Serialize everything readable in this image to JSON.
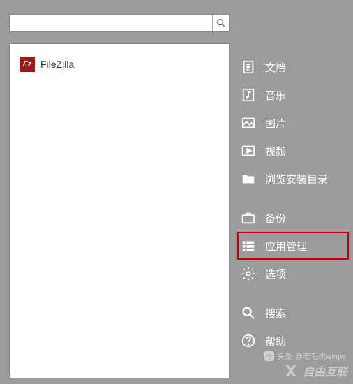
{
  "search": {
    "value": "",
    "placeholder": ""
  },
  "app_list": {
    "items": [
      {
        "icon_label": "Fz",
        "name": "FileZilla"
      }
    ]
  },
  "menu": {
    "group1": [
      {
        "key": "docs",
        "label": "文档"
      },
      {
        "key": "music",
        "label": "音乐"
      },
      {
        "key": "pictures",
        "label": "图片"
      },
      {
        "key": "video",
        "label": "视频"
      },
      {
        "key": "browse-install",
        "label": "浏览安装目录"
      }
    ],
    "group2": [
      {
        "key": "backup",
        "label": "备份"
      },
      {
        "key": "app-manage",
        "label": "应用管理",
        "highlighted": true
      },
      {
        "key": "options",
        "label": "选项"
      }
    ],
    "group3": [
      {
        "key": "search",
        "label": "搜索"
      },
      {
        "key": "help",
        "label": "帮助"
      }
    ]
  },
  "watermark": {
    "text": "自由互联"
  },
  "attribution": {
    "prefix": "头条",
    "user": "@老毛桃winpe"
  }
}
